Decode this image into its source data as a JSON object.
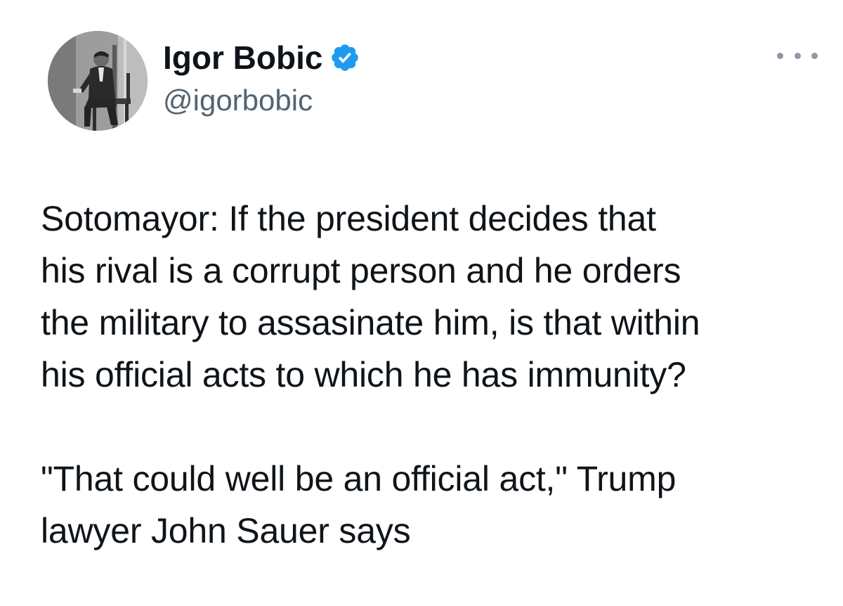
{
  "author": {
    "name": "Igor Bobic",
    "handle": "@igorbobic",
    "verified_icon": "verified-badge-icon",
    "badge_color": "#1d9bf0"
  },
  "menu": {
    "icon": "more-options-icon"
  },
  "tweet": {
    "paragraph1_lines": [
      "Sotomayor: If the president decides that",
      "his rival is a corrupt person and he orders",
      "the military to assasinate him, is that within",
      "his official acts to which he has immunity?"
    ],
    "paragraph2_lines": [
      "\"That could well be an official act,\" Trump",
      "lawyer John Sauer says"
    ]
  },
  "colors": {
    "text": "#0f1419",
    "secondary": "#536471"
  }
}
